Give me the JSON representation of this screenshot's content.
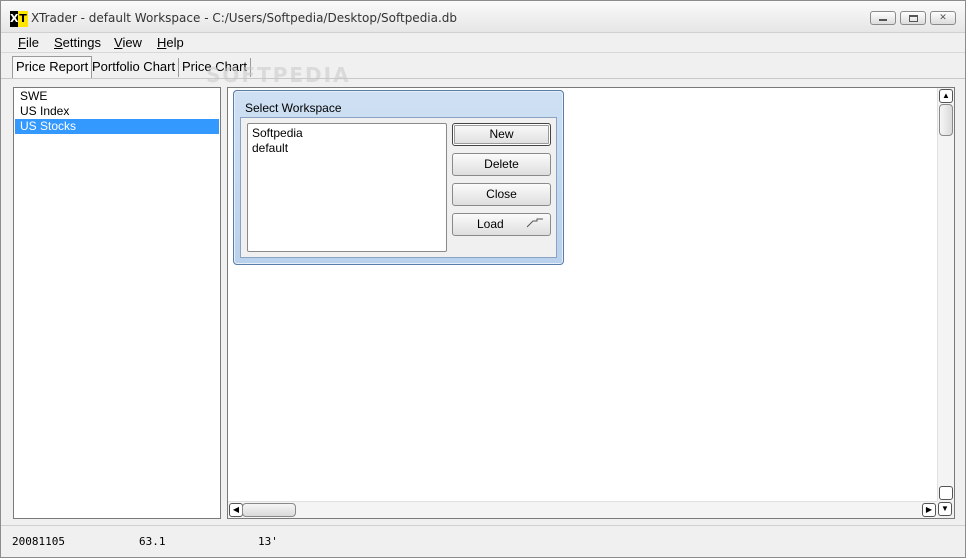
{
  "window": {
    "icon_x": "X",
    "icon_t": "T",
    "title": "XTrader - default Workspace - C:/Users/Softpedia/Desktop/Softpedia.db"
  },
  "menu": {
    "items": [
      {
        "label": "File",
        "underline": "F",
        "rest": "ile"
      },
      {
        "label": "Settings",
        "underline": "S",
        "rest": "ettings"
      },
      {
        "label": "View",
        "underline": "V",
        "rest": "iew"
      },
      {
        "label": "Help",
        "underline": "H",
        "rest": "elp"
      }
    ]
  },
  "tabs": [
    {
      "label": "Price Report",
      "active": true
    },
    {
      "label": "Portfolio Chart",
      "active": false
    },
    {
      "label": "Price Chart",
      "active": false
    }
  ],
  "watermark": "SOFTPEDIA",
  "left_list": {
    "items": [
      "SWE",
      "US Index",
      "US Stocks"
    ],
    "selected_index": 2
  },
  "dialog": {
    "title": "Select Workspace",
    "workspaces": [
      "Softpedia",
      "default"
    ],
    "buttons": {
      "new": "New",
      "delete": "Delete",
      "close": "Close",
      "load": "Load"
    }
  },
  "status": {
    "date": "20081105",
    "value": "63.1",
    "time": "13'"
  },
  "colors": {
    "selection": "#3399ff",
    "dialog_frame": "#b9d1ec",
    "icon_yellow": "#ffe600"
  }
}
